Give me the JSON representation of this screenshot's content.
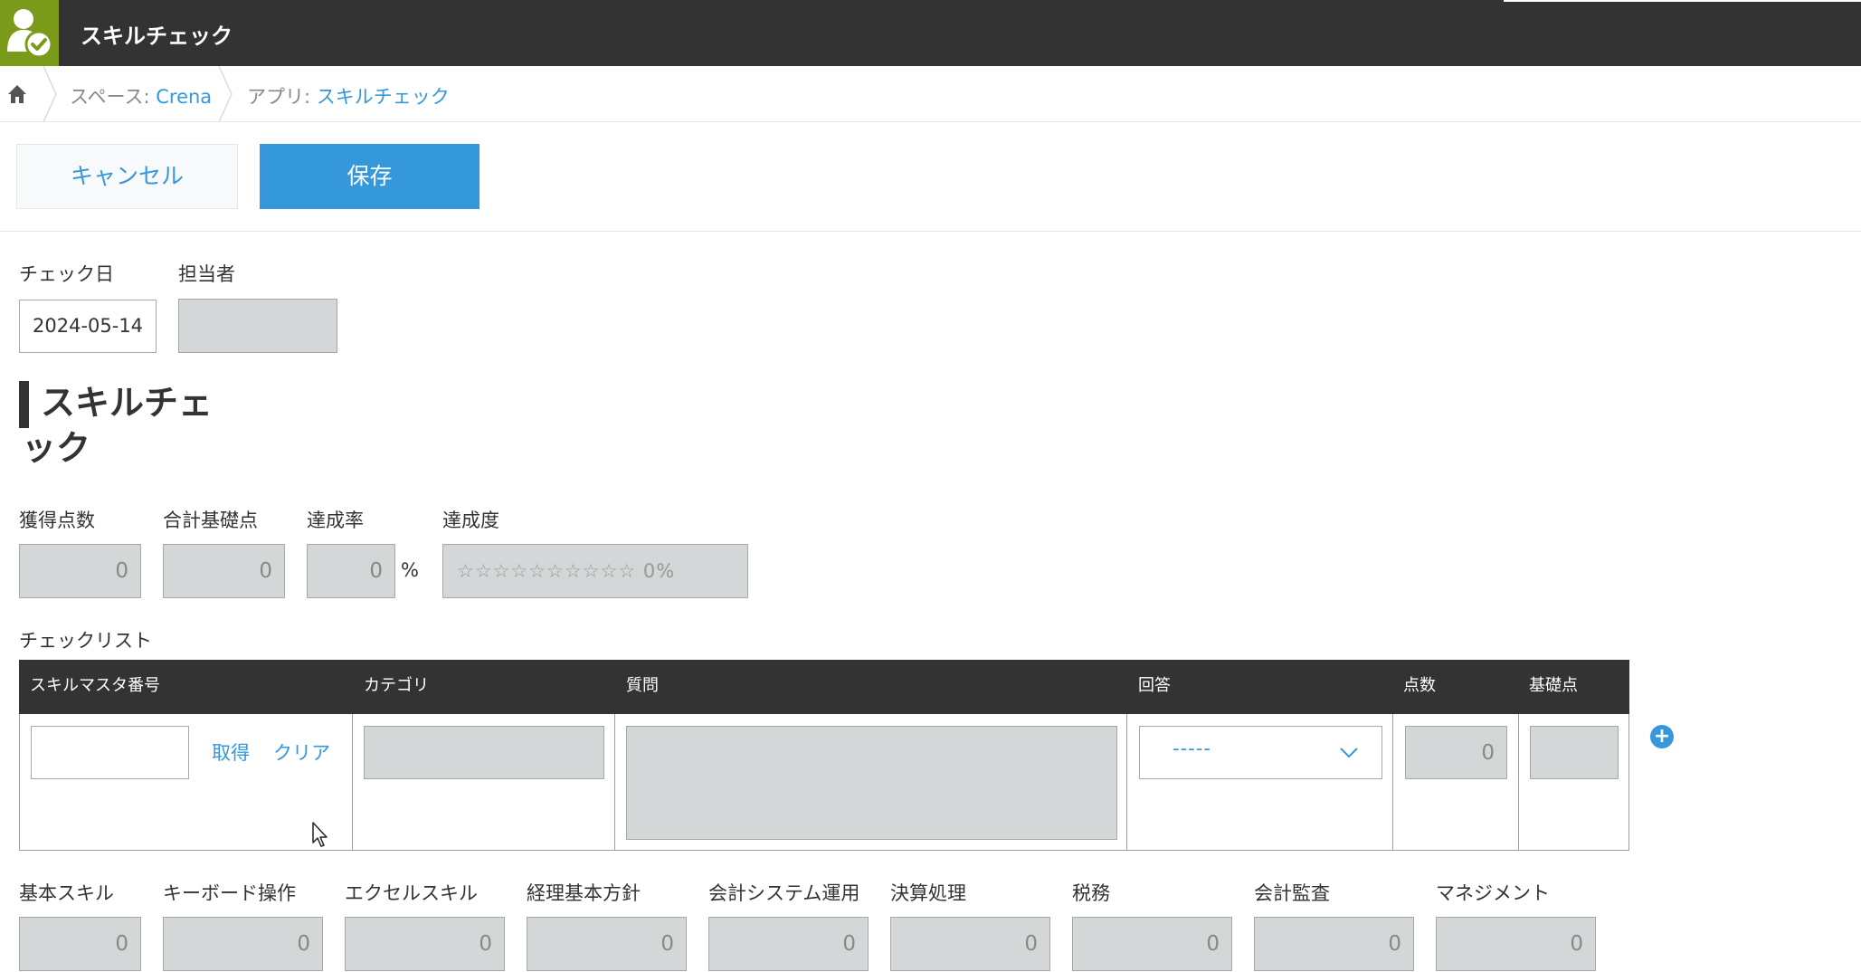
{
  "header": {
    "title": "スキルチェック",
    "app_icon": "app-user-check-icon"
  },
  "breadcrumb": {
    "home_icon": "home-icon",
    "space_prefix": "スペース: ",
    "space_name": "Crena",
    "app_prefix": "アプリ: ",
    "app_name": "スキルチェック"
  },
  "actions": {
    "cancel_label": "キャンセル",
    "save_label": "保存"
  },
  "form": {
    "check_date_label": "チェック日",
    "check_date_value": "2024-05-14",
    "assignee_label": "担当者",
    "assignee_value": "",
    "section_title_1": "スキルチェ",
    "section_title_2": "ック",
    "score": {
      "label": "獲得点数",
      "value": "0"
    },
    "total_base": {
      "label": "合計基礎点",
      "value": "0"
    },
    "rate": {
      "label": "達成率",
      "value": "0",
      "unit": "%"
    },
    "degree": {
      "label": "達成度",
      "value": "☆☆☆☆☆☆☆☆☆☆ 0%"
    }
  },
  "checklist": {
    "label": "チェックリスト",
    "columns": [
      "スキルマスタ番号",
      "カテゴリ",
      "質問",
      "回答",
      "点数",
      "基礎点"
    ],
    "row": {
      "skill_no": "",
      "get_label": "取得",
      "clear_label": "クリア",
      "category": "",
      "question": "",
      "answer": "-----",
      "points": "0",
      "base_points": ""
    },
    "add_icon": "plus-circle-icon"
  },
  "skills": [
    {
      "label": "基本スキル",
      "value": "0"
    },
    {
      "label": "キーボード操作",
      "value": "0"
    },
    {
      "label": "エクセルスキル",
      "value": "0"
    },
    {
      "label": "経理基本方針",
      "value": "0"
    },
    {
      "label": "会計システム運用",
      "value": "0"
    },
    {
      "label": "決算処理",
      "value": "0"
    },
    {
      "label": "税務",
      "value": "0"
    },
    {
      "label": "会計監査",
      "value": "0"
    },
    {
      "label": "マネジメント",
      "value": "0"
    }
  ],
  "colors": {
    "header_bg": "#333333",
    "app_icon_bg": "#7a9a1a",
    "accent": "#3498db",
    "readonly_field": "#d4d7d7"
  }
}
